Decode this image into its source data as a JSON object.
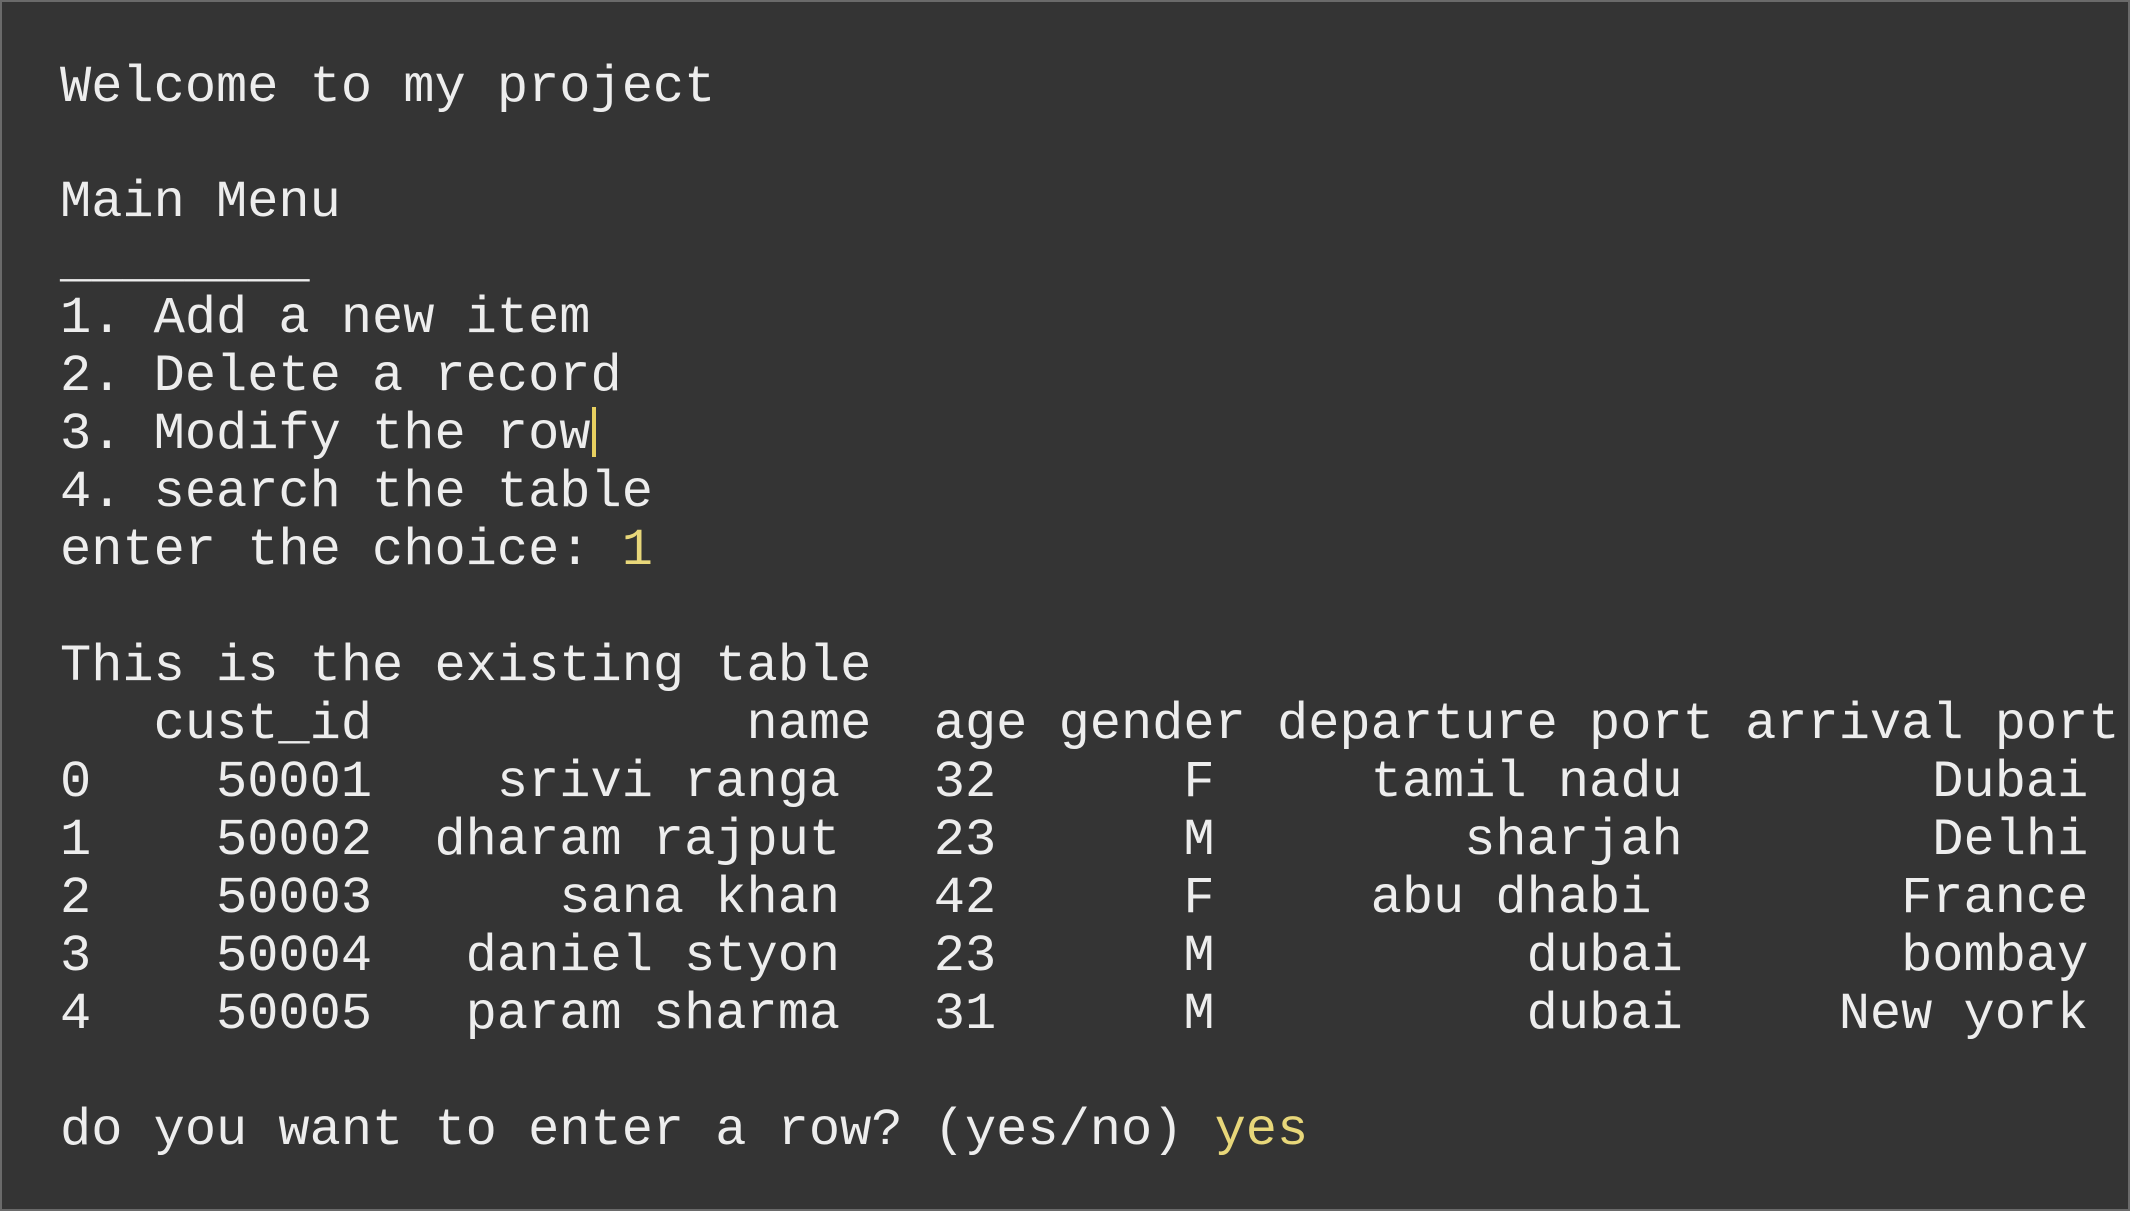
{
  "terminal": {
    "welcome": "Welcome to my project",
    "menu_title": "Main Menu",
    "menu_rule": "________",
    "menu_items": [
      "1. Add a new item",
      "2. Delete a record",
      "3. Modify the row",
      "4. search the table"
    ],
    "choice_prompt": "enter the choice: ",
    "choice_value": "1",
    "table_intro": "This is the existing table",
    "table_header": "   cust_id            name  age gender departure port arrival port",
    "table_rows": [
      "0    50001    srivi ranga   32      F     tamil nadu        Dubai",
      "1    50002  dharam rajput   23      M        sharjah        Delhi",
      "2    50003      sana khan   42      F     abu dhabi        France",
      "3    50004   daniel styon   23      M          dubai       bombay",
      "4    50005   param sharma   31      M          dubai     New york"
    ],
    "row_prompt": "do you want to enter a row? (yes/no) ",
    "row_answer": "yes"
  },
  "colors": {
    "background": "#343434",
    "output_text": "#ededed",
    "user_input": "#e8d77a",
    "caret": "#e8d060"
  }
}
